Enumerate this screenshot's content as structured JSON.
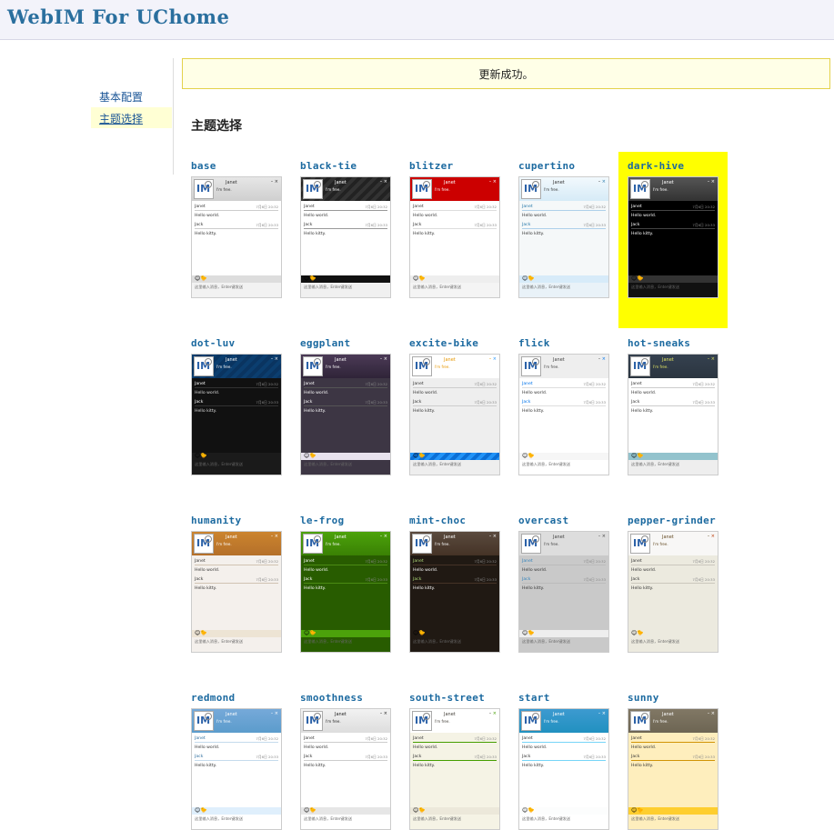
{
  "header": {
    "title": "WebIM For UChome"
  },
  "sidebar": {
    "items": [
      {
        "label": "基本配置"
      },
      {
        "label": "主题选择"
      }
    ]
  },
  "notice": {
    "text": "更新成功。"
  },
  "section": {
    "title": "主题选择"
  },
  "preview": {
    "logo": "IM",
    "name": "Janet",
    "status": "I'm free.",
    "controls": "–",
    "msg1_user": "Janet",
    "msg1_time": "7月6日 20:32",
    "msg1_text": "Hello world.",
    "msg2_user": "Jack",
    "msg2_time": "7月6日 20:33",
    "msg2_text": "Hello kitty.",
    "emoticons": "😊🐤",
    "input_placeholder": "这里输入消息，Enter键发送"
  },
  "themes": [
    {
      "name": "base"
    },
    {
      "name": "black-tie"
    },
    {
      "name": "blitzer"
    },
    {
      "name": "cupertino"
    },
    {
      "name": "dark-hive",
      "selected": true
    },
    {
      "name": "dot-luv"
    },
    {
      "name": "eggplant"
    },
    {
      "name": "excite-bike"
    },
    {
      "name": "flick"
    },
    {
      "name": "hot-sneaks"
    },
    {
      "name": "humanity"
    },
    {
      "name": "le-frog"
    },
    {
      "name": "mint-choc"
    },
    {
      "name": "overcast"
    },
    {
      "name": "pepper-grinder"
    },
    {
      "name": "redmond"
    },
    {
      "name": "smoothness"
    },
    {
      "name": "south-street"
    },
    {
      "name": "start"
    },
    {
      "name": "sunny"
    }
  ]
}
